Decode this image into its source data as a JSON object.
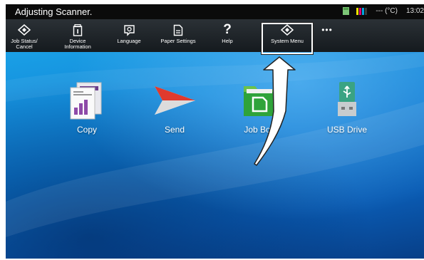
{
  "status": {
    "title": "Adjusting Scanner.",
    "temperature": "--- (°C)",
    "time": "13:02",
    "toner_colors": [
      "#f2e200",
      "#e0007a",
      "#00a6e0",
      "#3a3a3a"
    ]
  },
  "toolbar": {
    "items": [
      {
        "label": "Job Status/\nCancel",
        "icon": "job-status-icon"
      },
      {
        "label": "Device\nInformation",
        "icon": "device-info-icon"
      },
      {
        "label": "Language",
        "icon": "language-icon"
      },
      {
        "label": "Paper Settings",
        "icon": "paper-settings-icon"
      },
      {
        "label": "Help",
        "icon": "help-icon"
      },
      {
        "label": "System Menu",
        "icon": "system-menu-icon"
      },
      {
        "label": "•••",
        "icon": "more-icon"
      }
    ]
  },
  "apps": [
    {
      "label": "Copy",
      "icon": "copy-icon"
    },
    {
      "label": "Send",
      "icon": "send-icon"
    },
    {
      "label": "Job Box",
      "icon": "job-box-icon"
    },
    {
      "label": "USB Drive",
      "icon": "usb-drive-icon"
    }
  ],
  "annotation": {
    "target": "System Menu",
    "accent": "#ffffff"
  }
}
